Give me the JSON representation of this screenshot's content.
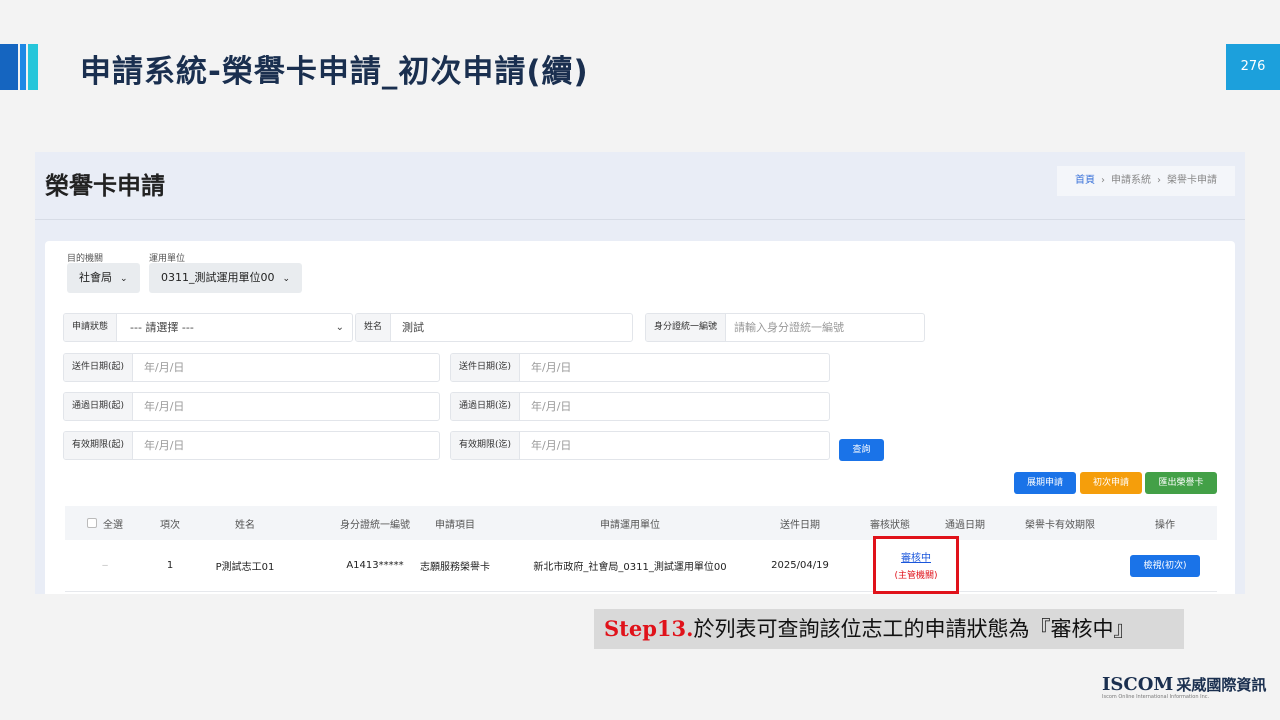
{
  "slide": {
    "title": "申請系統-榮譽卡申請_初次申請(續)",
    "page_number": "276",
    "accent_colors": [
      "#1565c0",
      "#1e88e5",
      "#26c6da"
    ]
  },
  "app": {
    "page_title": "榮譽卡申請",
    "breadcrumb": [
      "首頁",
      "申請系統",
      "榮譽卡申請"
    ],
    "breadcrumb_separator": "›"
  },
  "filters": {
    "agency_label": "目的機關",
    "agency_value": "社會局",
    "unit_label": "運用單位",
    "unit_value": "0311_測試運用單位00",
    "status_label": "申請狀態",
    "status_value": "--- 請選擇 ---",
    "name_label": "姓名",
    "name_value": "測試",
    "id_label": "身分證統一編號",
    "id_placeholder": "請輸入身分證統一編號",
    "send_start_label": "送件日期(起)",
    "send_end_label": "送件日期(迄)",
    "pass_start_label": "通過日期(起)",
    "pass_end_label": "通過日期(迄)",
    "valid_start_label": "有效期限(起)",
    "valid_end_label": "有效期限(迄)",
    "date_placeholder_1": "年/月/日",
    "date_placeholder_2": "年/月/日",
    "date_placeholder_3": "年/月/日",
    "date_placeholder_4": "年/月/日",
    "date_placeholder_5": "年/月/日",
    "date_placeholder_6": "年/月/日",
    "search_button": "查詢"
  },
  "actions": {
    "renew": "展期申請",
    "first": "初次申請",
    "export": "匯出榮譽卡"
  },
  "table": {
    "headers": {
      "select_all": "全選",
      "index": "項次",
      "name": "姓名",
      "id": "身分證統一編號",
      "item": "申請項目",
      "unit": "申請運用單位",
      "send_date": "送件日期",
      "review_status": "審核狀態",
      "pass_date": "通過日期",
      "valid_until": "榮譽卡有效期限",
      "operation": "操作"
    },
    "rows": [
      {
        "index": "1",
        "name": "P測試志工01",
        "id": "A1413*****",
        "item": "志願服務榮譽卡",
        "unit": "新北市政府_社會局_0311_測試運用單位00",
        "send_date": "2025/04/19",
        "review_status": "審核中",
        "review_sub": "(主管機關)",
        "pass_date": "",
        "valid_until": "",
        "action": "檢視(初次)"
      }
    ]
  },
  "caption": {
    "step": "Step13.",
    "text": "於列表可查詢該位志工的申請狀態為『審核中』"
  },
  "logo": {
    "brand": "ISCOM",
    "cn": "采威國際資訊",
    "en": "Iscom Online International Information Inc."
  }
}
